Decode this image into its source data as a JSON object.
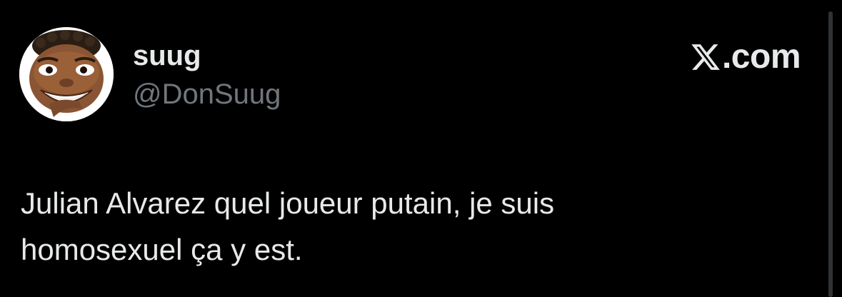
{
  "tweet": {
    "display_name": "suug",
    "handle": "@DonSuug",
    "text": "Julian Alvarez quel joueur putain, je suis\nhomosexuel ça y est."
  },
  "brand": {
    "domain": ".com",
    "logo_icon": "x-logo-icon"
  },
  "colors": {
    "background": "#000000",
    "primary_text": "#e7e9ea",
    "secondary_text": "#71767b"
  }
}
